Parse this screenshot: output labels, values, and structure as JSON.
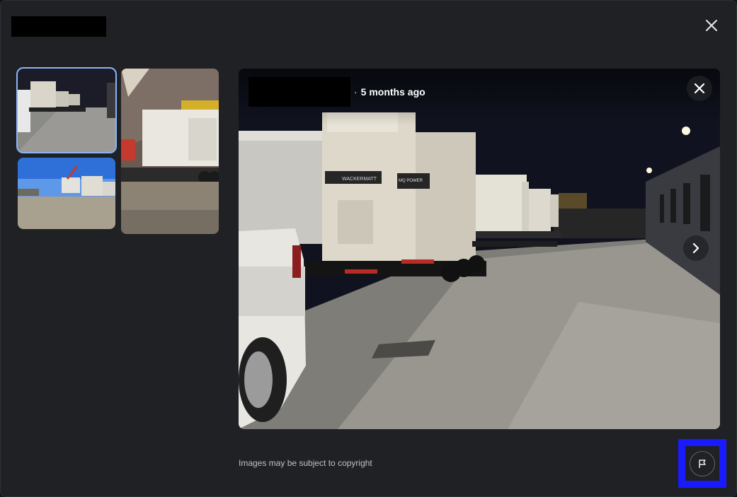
{
  "header": {
    "close_icon": "close-icon"
  },
  "thumbnails": [
    {
      "name": "generators-lot-night",
      "selected": true
    },
    {
      "name": "generator-warehouse",
      "selected": false
    },
    {
      "name": "generators-yard-day",
      "selected": false
    }
  ],
  "viewer": {
    "separator": "·",
    "timestamp": "5 months ago",
    "close_icon": "close-icon",
    "next_icon": "chevron-right-icon",
    "photo_signage": {
      "brand": "WACKERMATT",
      "model": "MQ POWER"
    }
  },
  "footer": {
    "copyright": "Images may be subject to copyright",
    "report_icon": "flag-icon"
  },
  "colors": {
    "dialog_bg": "#202124",
    "selected_outline": "#8ab4f8",
    "highlight": "#1a1aff"
  }
}
